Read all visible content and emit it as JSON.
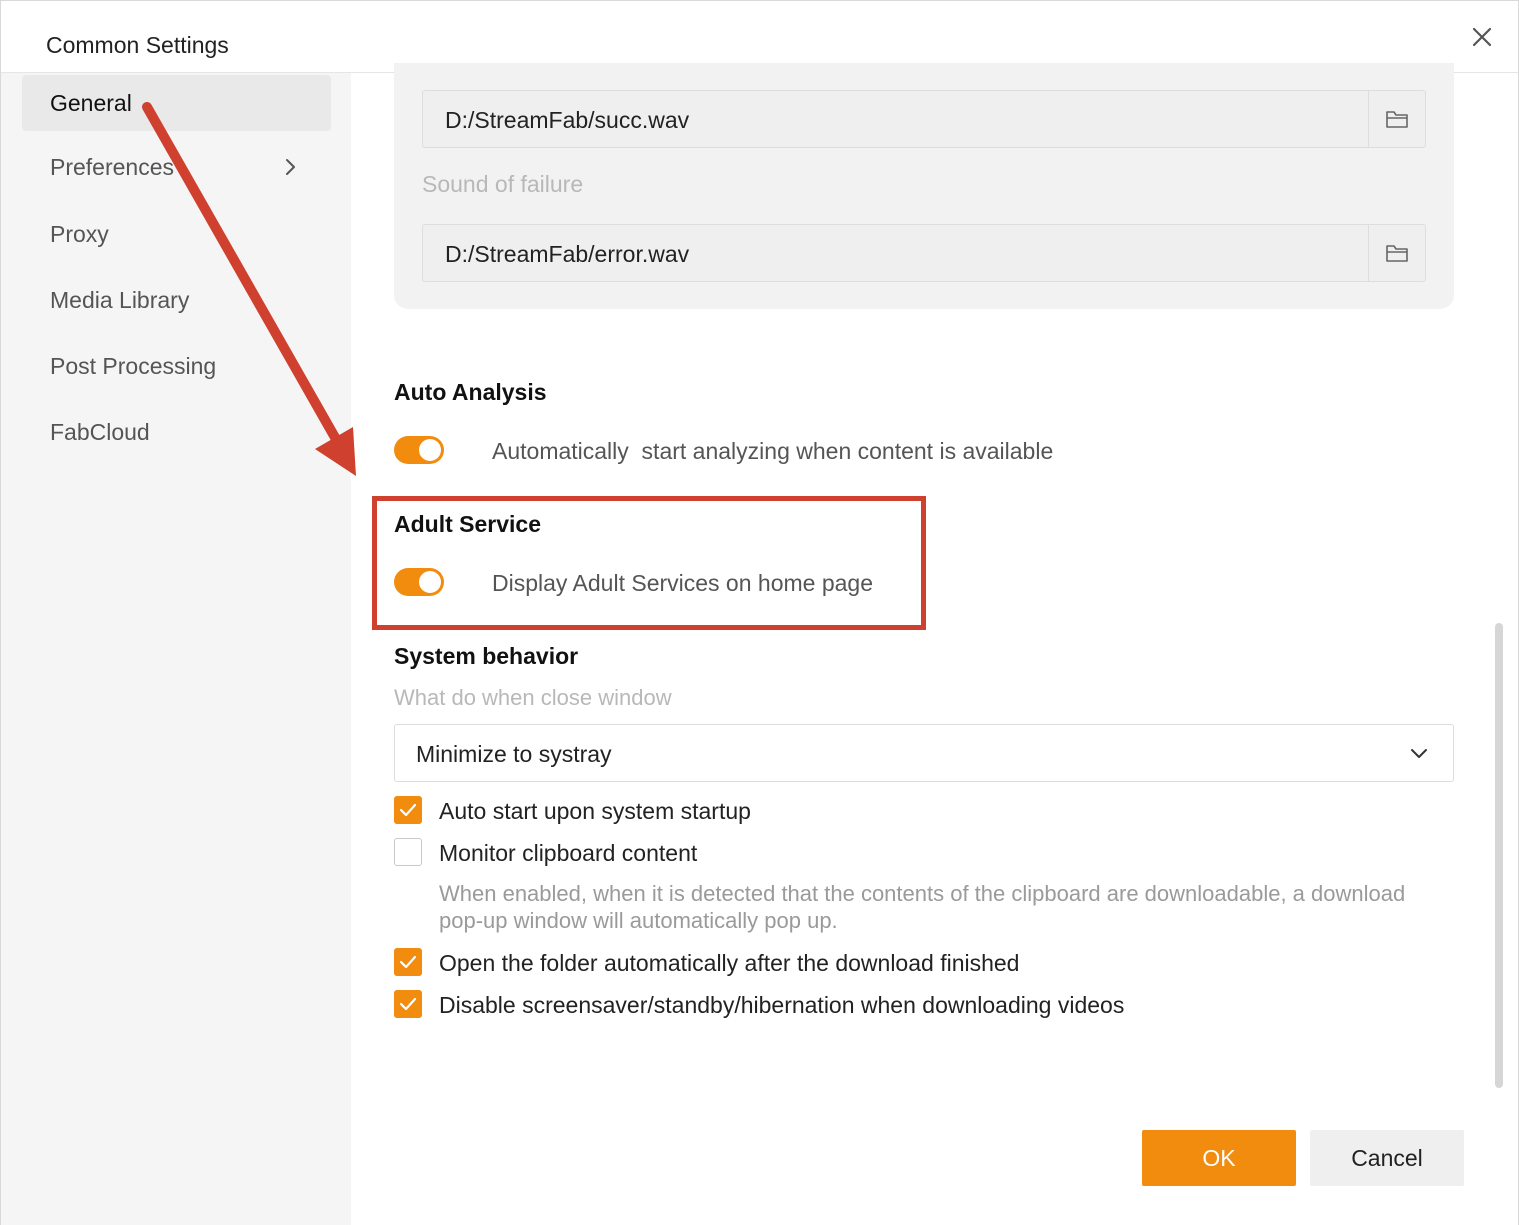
{
  "window": {
    "title": "Common Settings"
  },
  "sidebar": {
    "items": [
      {
        "label": "General"
      },
      {
        "label": "Preferences"
      },
      {
        "label": "Proxy"
      },
      {
        "label": "Media Library"
      },
      {
        "label": "Post Processing"
      },
      {
        "label": "FabCloud"
      }
    ],
    "active": "General"
  },
  "sounds": {
    "success_path": "D:/StreamFab/succ.wav",
    "failure_label": "Sound of failure",
    "failure_path": "D:/StreamFab/error.wav"
  },
  "auto_analysis": {
    "title": "Auto Analysis",
    "toggle_label": "Automatically  start analyzing when content is available",
    "enabled": true
  },
  "adult_service": {
    "title": "Adult Service",
    "toggle_label": "Display Adult Services on home page",
    "enabled": true
  },
  "system_behavior": {
    "title": "System behavior",
    "close_label": "What do when close window",
    "close_value": "Minimize to systray",
    "options": [
      {
        "label": "Auto start upon system startup",
        "checked": true
      },
      {
        "label": "Monitor clipboard content",
        "checked": false
      },
      {
        "label": "Open the folder automatically after the download finished",
        "checked": true
      },
      {
        "label": "Disable screensaver/standby/hibernation when downloading videos",
        "checked": true
      }
    ],
    "clipboard_hint": "When enabled, when it is detected that the contents of the clipboard are downloadable, a download pop-up window will automatically pop up."
  },
  "footer": {
    "ok_label": "OK",
    "cancel_label": "Cancel"
  },
  "colors": {
    "accent": "#f28c0f",
    "annotation": "#d0402e"
  },
  "icons": {
    "close": "close-icon",
    "folder": "folder-icon",
    "chevron_right": "chevron-right-icon",
    "chevron_down": "chevron-down-icon",
    "check": "check-icon"
  }
}
